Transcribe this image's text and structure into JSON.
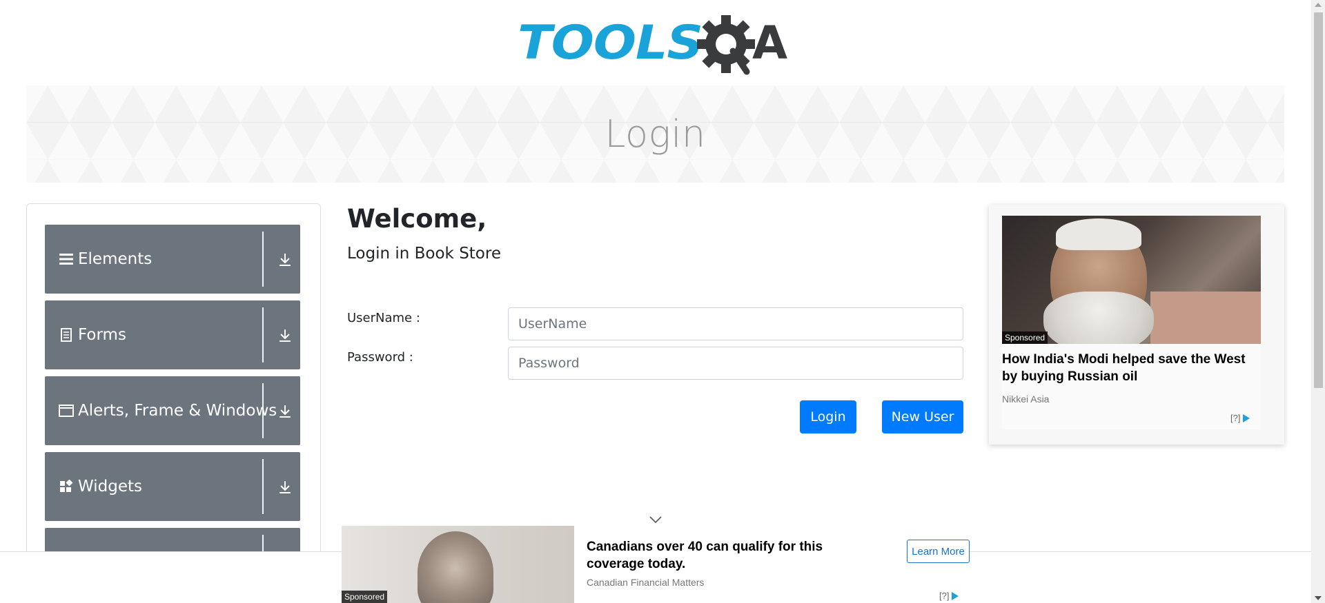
{
  "header": {
    "logo_text_left": "TOOLS",
    "logo_text_right": "A",
    "colors": {
      "tools_blue": "#1aa3d9",
      "qa_dark": "#3a3b3c"
    }
  },
  "banner": {
    "title": "Login"
  },
  "sidebar": {
    "groups": [
      {
        "label": "Elements",
        "icon": "hamburger-icon"
      },
      {
        "label": "Forms",
        "icon": "document-icon"
      },
      {
        "label": "Alerts, Frame & Windows",
        "icon": "window-icon"
      },
      {
        "label": "Widgets",
        "icon": "widgets-icon"
      },
      {
        "label": "",
        "icon": ""
      }
    ]
  },
  "main": {
    "welcome": "Welcome,",
    "subtitle": "Login in Book Store",
    "username_label": "UserName :",
    "username_placeholder": "UserName",
    "username_value": "",
    "password_label": "Password :",
    "password_placeholder": "Password",
    "password_value": "",
    "login_button": "Login",
    "new_user_button": "New User",
    "accent": "#007bff"
  },
  "ad_right": {
    "sponsored": "Sponsored",
    "headline": "How India's Modi helped save the West by buying Russian oil",
    "source": "Nikkei Asia",
    "adchoices": "[?]"
  },
  "ad_bottom": {
    "sponsored": "Sponsored",
    "headline": "Canadians over 40 can qualify for this coverage today.",
    "source": "Canadian Financial Matters",
    "cta": "Learn More",
    "adchoices": "[?]"
  }
}
